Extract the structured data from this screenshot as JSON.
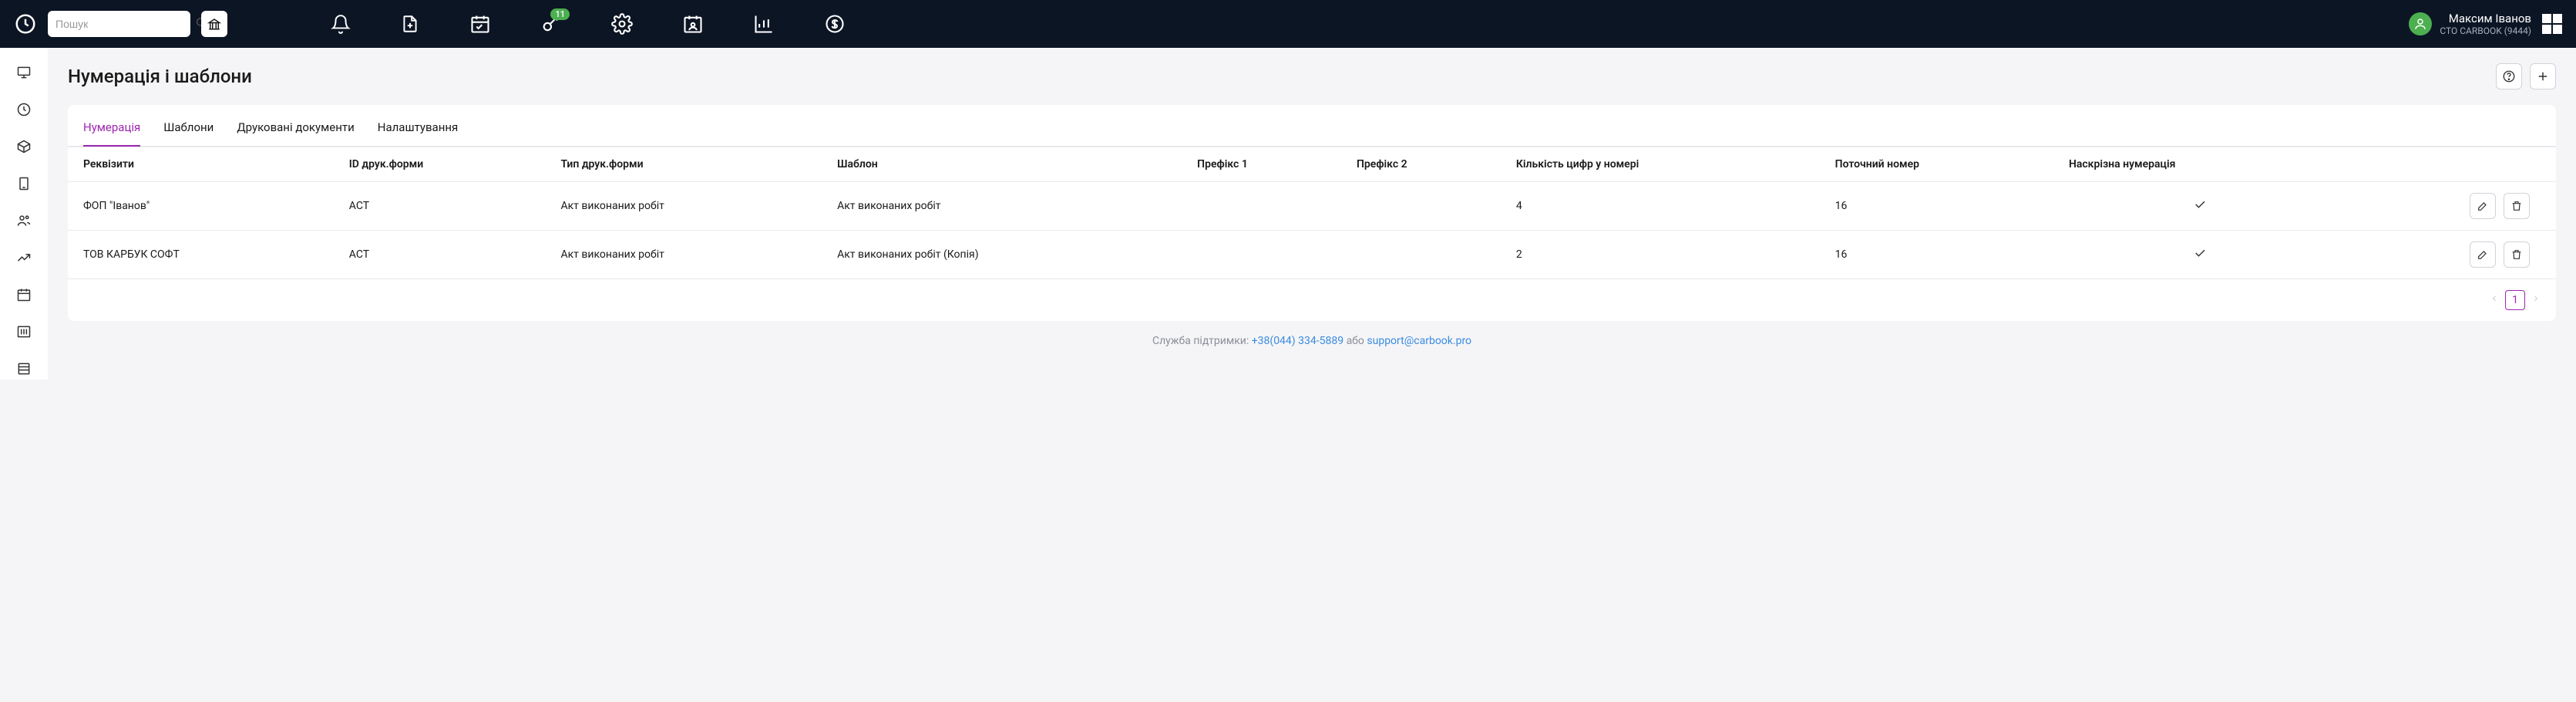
{
  "search": {
    "placeholder": "Пошук"
  },
  "badge": {
    "count": "11"
  },
  "user": {
    "name": "Максим Іванов",
    "sub": "СТО CARBOOK (9444)"
  },
  "page": {
    "title": "Нумерація і шаблони"
  },
  "tabs": [
    {
      "label": "Нумерація"
    },
    {
      "label": "Шаблони"
    },
    {
      "label": "Друковані документи"
    },
    {
      "label": "Налаштування"
    }
  ],
  "columns": {
    "c0": "Реквізити",
    "c1": "ID друк.форми",
    "c2": "Тип друк.форми",
    "c3": "Шаблон",
    "c4": "Префікс 1",
    "c5": "Префікс 2",
    "c6": "Кількість цифр у номері",
    "c7": "Поточний номер",
    "c8": "Наскрізна нумерація"
  },
  "rows": [
    {
      "req": "ФОП \"Іванов\"",
      "id": "ACT",
      "type": "Акт виконаних робіт",
      "tpl": "Акт виконаних робіт",
      "p1": "",
      "p2": "",
      "digits": "4",
      "current": "16"
    },
    {
      "req": "ТОВ КАРБУК СОФТ",
      "id": "ACT",
      "type": "Акт виконаних робіт",
      "tpl": "Акт виконаних робіт (Копія)",
      "p1": "",
      "p2": "",
      "digits": "2",
      "current": "16"
    }
  ],
  "pagination": {
    "page": "1"
  },
  "footer": {
    "label": "Служба підтримки: ",
    "phone": "+38(044) 334-5889",
    "sep": " або ",
    "email": "support@carbook.pro"
  }
}
